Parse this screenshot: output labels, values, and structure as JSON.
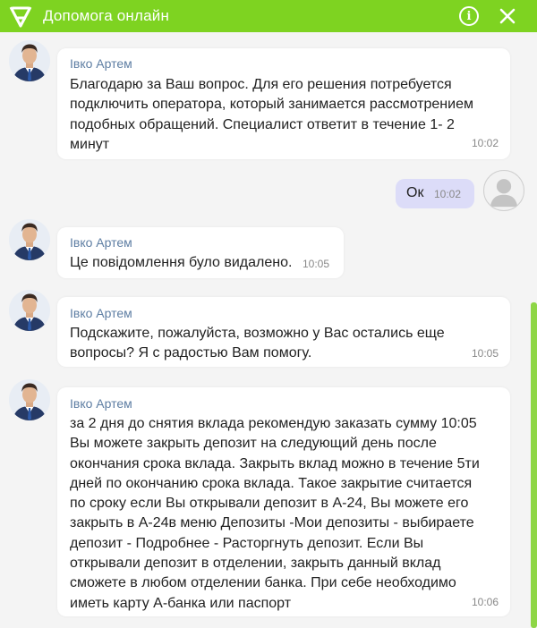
{
  "header": {
    "title": "Допомога онлайн",
    "brand_color": "#7ed321"
  },
  "messages": [
    {
      "author": "Івко Артем",
      "text": "Благодарю за Ваш вопрос. Для его решения потребуется\nподключить оператора, который занимается рассмотрением\nподобных обращений. Специалист ответит в течение 1- 2\nминут",
      "time": "10:02"
    },
    {
      "text": "Ок",
      "time": "10:02"
    },
    {
      "author": "Івко Артем",
      "text": "Це повідомлення було видалено.",
      "time": "10:05"
    },
    {
      "author": "Івко Артем",
      "text": "Подскажите, пожалуйста, возможно у Вас остались еще\nвопросы? Я с радостью Вам помогу.",
      "time": "10:05"
    },
    {
      "author": "Івко Артем",
      "text": "за 2 дня до снятия вклада рекомендую заказать сумму 10:05\nВы можете закрыть депозит на следующий день после\nокончания срока вклада. Закрыть вклад можно в течение 5ти\nдней по окончанию срока вклада. Такое закрытие считается\nпо сроку если Вы открывали депозит в А-24, Вы можете его\nзакрыть в А-24в меню Депозиты -Мои депозиты - выбираете\nдепозит - Подробнее - Расторгнуть депозит. Если Вы\nоткрывали депозит в отделении, закрыть данный вклад\nсможете в любом отделении банка. При себе необходимо\nиметь карту А-банка или паспорт",
      "time": "10:06"
    }
  ]
}
